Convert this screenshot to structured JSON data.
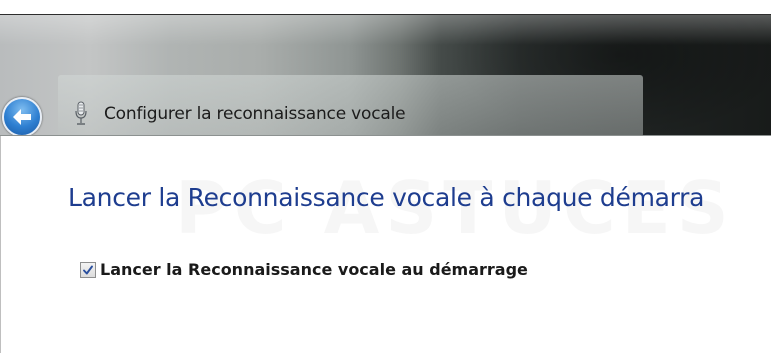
{
  "window": {
    "title": "Configurer la reconnaissance vocale"
  },
  "icons": {
    "back": "back-arrow-icon",
    "microphone": "microphone-icon",
    "checkmark": "checkmark-icon"
  },
  "content": {
    "heading": "Lancer la Reconnaissance vocale à chaque démarra",
    "startup_checkbox": {
      "label": "Lancer la Reconnaissance vocale au démarrage",
      "checked": true
    },
    "watermark": "PC ASTUCES"
  },
  "colors": {
    "heading": "#1e3d8f",
    "back_button": "#2e7fd1"
  }
}
